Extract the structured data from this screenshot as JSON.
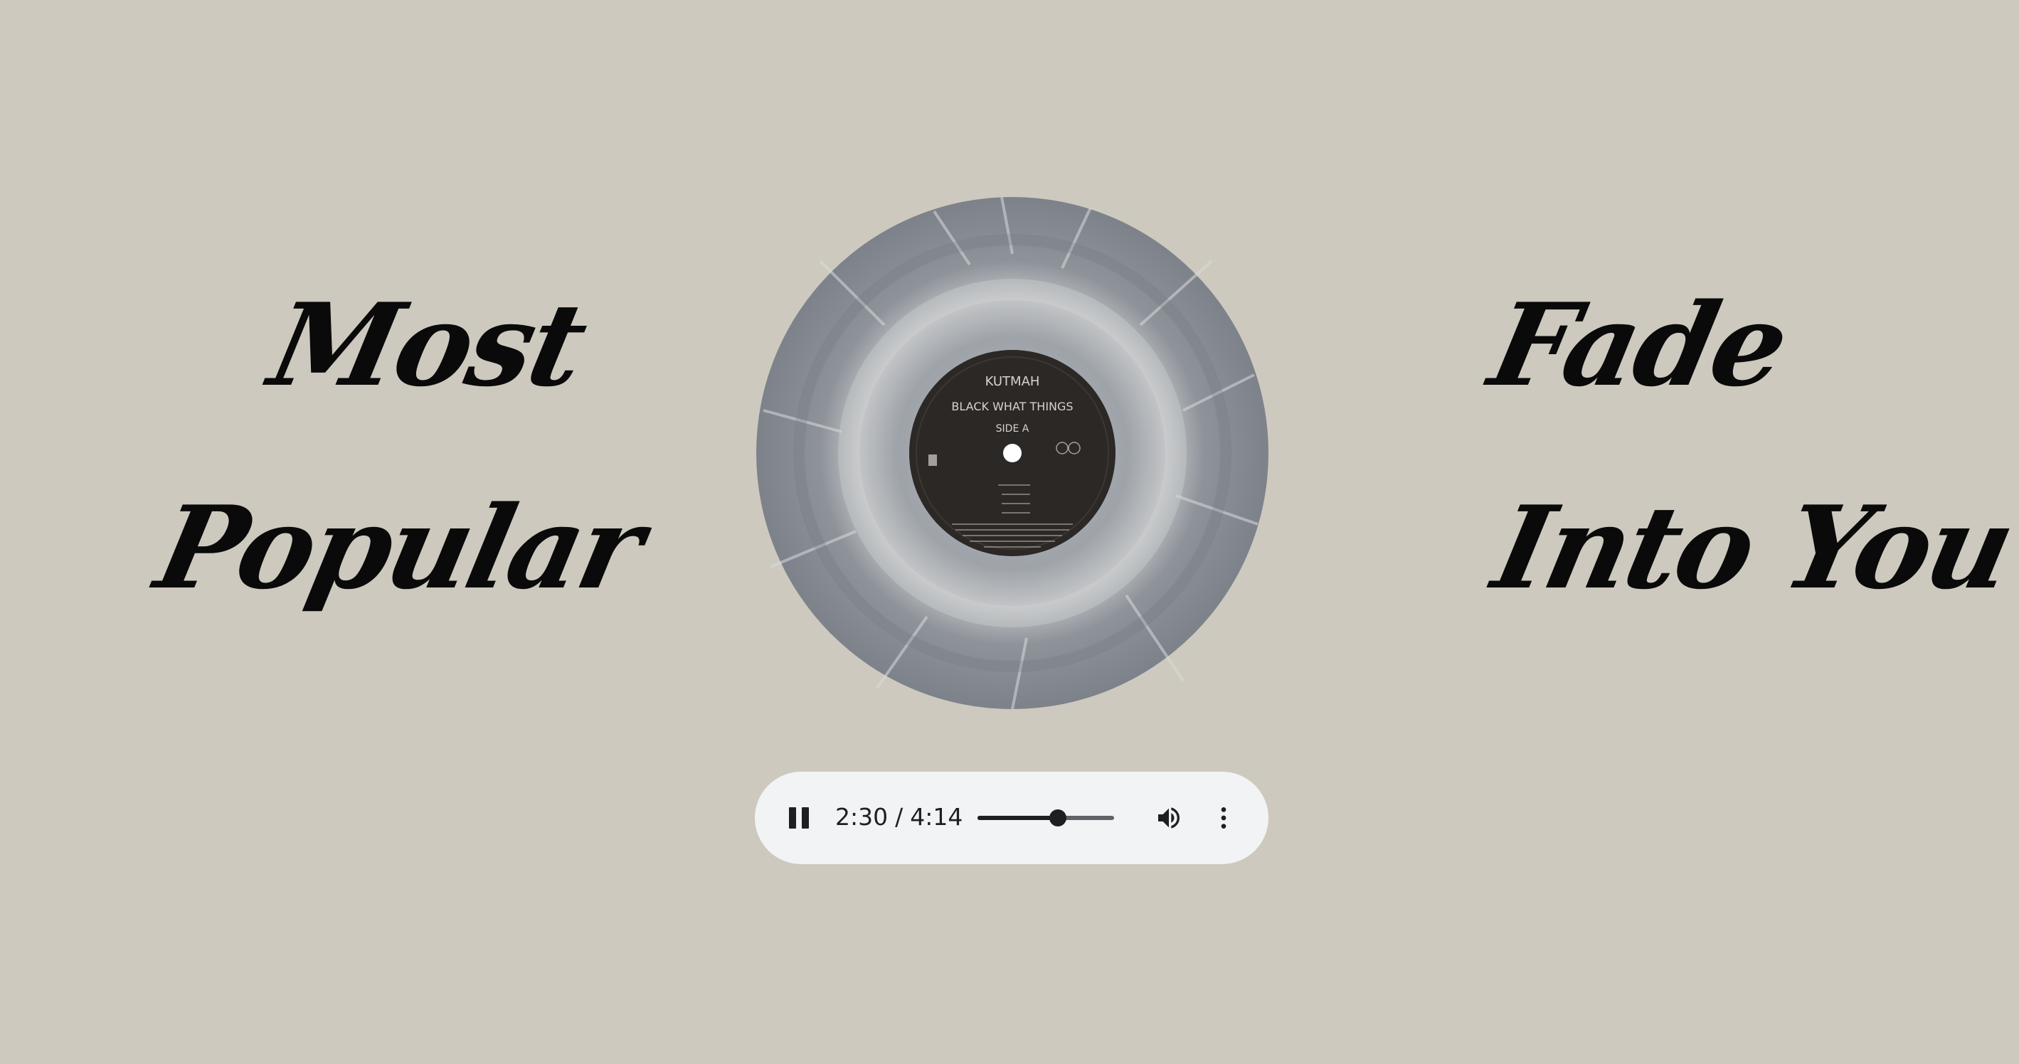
{
  "left_text": {
    "line1": "Most",
    "line2": "Popular"
  },
  "right_text": {
    "line1": "Fade",
    "line2": "Into You"
  },
  "record": {
    "label_line1": "KUTMAH",
    "label_line2": "BLACK WHAT THINGS",
    "label_line3": "SIDE A"
  },
  "player": {
    "state": "playing",
    "current_time": "2:30",
    "separator": "/",
    "duration": "4:14",
    "progress": 0.59,
    "pause_icon": "pause-icon",
    "volume_icon": "volume-icon",
    "menu_icon": "more-vert-icon"
  },
  "colors": {
    "background": "#cdc9be",
    "player_background": "#f1f3f4",
    "text": "#0a0a0a"
  }
}
